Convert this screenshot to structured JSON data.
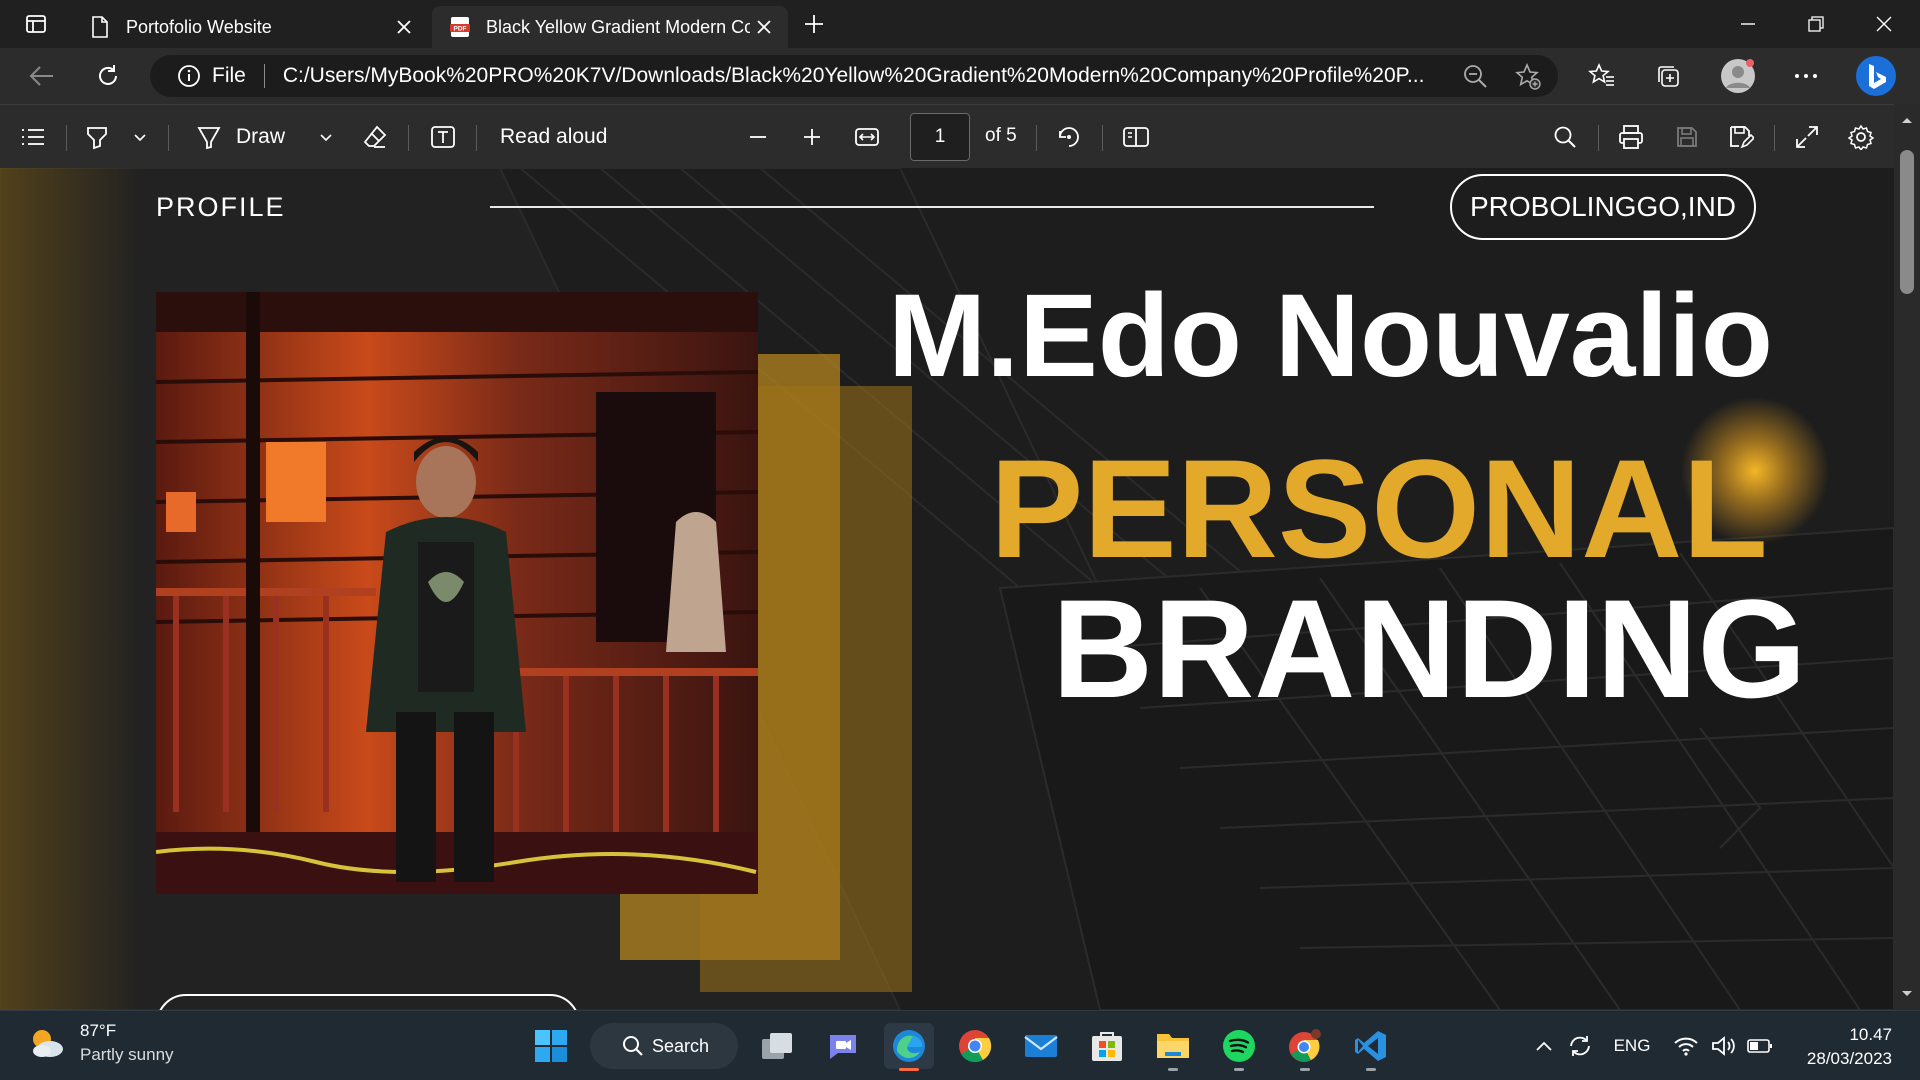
{
  "browser": {
    "tabs": [
      {
        "label": "Portofolio Website",
        "icon": "page-icon",
        "active": false
      },
      {
        "label": "Black Yellow Gradient Modern Company Profile",
        "icon": "pdf-icon",
        "active": true
      }
    ],
    "address": {
      "scheme": "File",
      "url": "C:/Users/MyBook%20PRO%20K7V/Downloads/Black%20Yellow%20Gradient%20Modern%20Company%20Profile%20P..."
    }
  },
  "pdf_toolbar": {
    "draw_label": "Draw",
    "read_aloud_label": "Read aloud",
    "page_current": "1",
    "page_total": "of 5"
  },
  "document": {
    "profile_label": "PROFILE",
    "location": "PROBOLINGGO,IND",
    "name": "M.Edo Nouvalio",
    "headline_1": "PERSONAL",
    "headline_2": "BRANDING",
    "accent_color": "#e2a92b"
  },
  "taskbar": {
    "weather_temp": "87°F",
    "weather_desc": "Partly sunny",
    "search_label": "Search",
    "language": "ENG",
    "time": "10.47",
    "date": "28/03/2023"
  }
}
